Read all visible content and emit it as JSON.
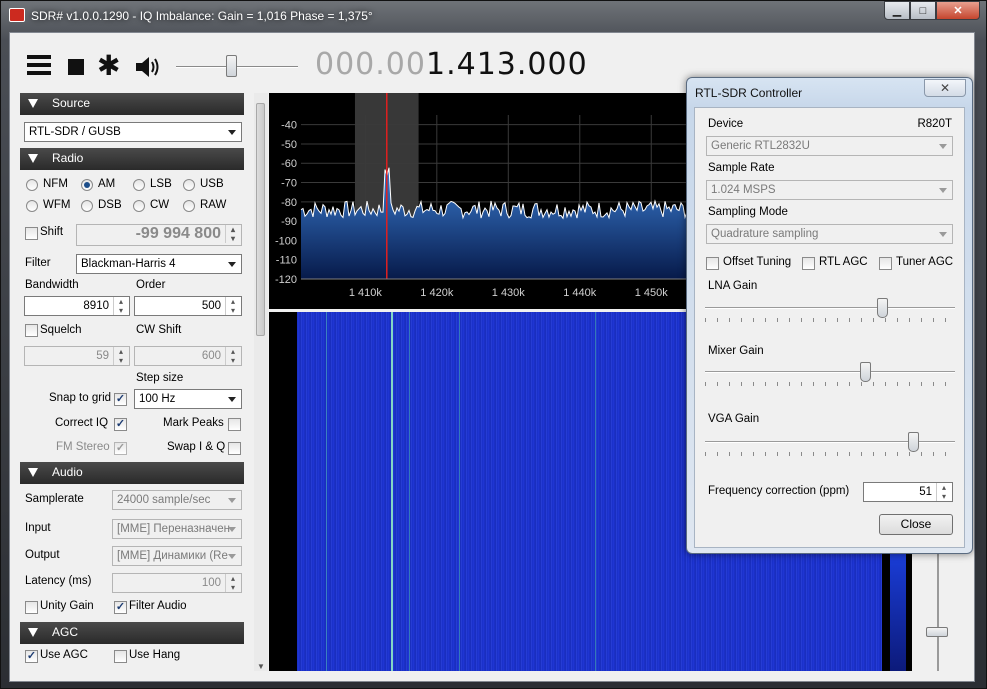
{
  "window": {
    "title": "SDR# v1.0.0.1290 - IQ Imbalance: Gain = 1,016 Phase = 1,375°",
    "minimize_glyph": "▁",
    "maximize_glyph": "□",
    "close_glyph": "✕"
  },
  "toolbar": {
    "frequency_dim": "000.00",
    "frequency_lit": "1.413.000",
    "gear_glyph": "✱"
  },
  "source": {
    "header": "Source",
    "device": "RTL-SDR / GUSB"
  },
  "radio": {
    "header": "Radio",
    "modes": [
      {
        "label": "NFM",
        "selected": false
      },
      {
        "label": "AM",
        "selected": true
      },
      {
        "label": "LSB",
        "selected": false
      },
      {
        "label": "USB",
        "selected": false
      },
      {
        "label": "WFM",
        "selected": false
      },
      {
        "label": "DSB",
        "selected": false
      },
      {
        "label": "CW",
        "selected": false
      },
      {
        "label": "RAW",
        "selected": false
      }
    ],
    "shift_label": "Shift",
    "shift_value": "-99 994 800",
    "filter_label": "Filter",
    "filter_value": "Blackman-Harris 4",
    "bandwidth_label": "Bandwidth",
    "bandwidth_value": "8910",
    "order_label": "Order",
    "order_value": "500",
    "squelch_label": "Squelch",
    "squelch_value": "59",
    "cwshift_label": "CW Shift",
    "cwshift_value": "600",
    "step_size_label": "Step size",
    "step_size_value": "100 Hz",
    "snap_label": "Snap to grid",
    "correct_iq_label": "Correct IQ",
    "mark_peaks_label": "Mark Peaks",
    "fm_stereo_label": "FM Stereo",
    "swap_iq_label": "Swap I & Q",
    "check_glyph": "✓"
  },
  "audio": {
    "header": "Audio",
    "samplerate_label": "Samplerate",
    "samplerate_value": "24000 sample/sec",
    "input_label": "Input",
    "input_value": "[MME] Переназначен",
    "output_label": "Output",
    "output_value": "[MME] Динамики (Re",
    "latency_label": "Latency (ms)",
    "latency_value": "100",
    "unity_gain_label": "Unity Gain",
    "filter_audio_label": "Filter Audio"
  },
  "agc": {
    "header": "AGC",
    "use_agc_label": "Use AGC",
    "use_hang_label": "Use Hang"
  },
  "chart_data": {
    "type": "line",
    "title": "",
    "xlabel": "",
    "ylabel": "",
    "y_ticks": [
      "-40",
      "-50",
      "-60",
      "-70",
      "-80",
      "-90",
      "-100",
      "-110",
      "-120"
    ],
    "x_ticks": [
      "1 410k",
      "1 420k",
      "1 430k",
      "1 440k",
      "1 450k"
    ],
    "x_tick_values": [
      1410000,
      1420000,
      1430000,
      1440000,
      1450000
    ],
    "ylim": [
      -120,
      -35
    ],
    "xlim": [
      1401000,
      1455000
    ],
    "noise_floor_db": -84,
    "peak": {
      "x": 1413000,
      "y": -67
    },
    "passband": [
      1408550,
      1417450
    ],
    "grid": true,
    "colors": {
      "trace": "#ffffff",
      "fill_top": "#3a7cd0",
      "fill_bottom": "#071a4a",
      "grid": "#3a3a3a",
      "tuned": "#e02020"
    }
  },
  "controller": {
    "title": "RTL-SDR Controller",
    "close_glyph": "✕",
    "device_label": "Device",
    "tuner": "R820T",
    "device_value": "Generic RTL2832U",
    "sample_rate_label": "Sample Rate",
    "sample_rate_value": "1.024 MSPS",
    "sampling_mode_label": "Sampling Mode",
    "sampling_mode_value": "Quadrature sampling",
    "offset_tuning_label": "Offset Tuning",
    "rtl_agc_label": "RTL AGC",
    "tuner_agc_label": "Tuner AGC",
    "lna_gain_label": "LNA Gain",
    "lna_gain_level": 0.72,
    "mixer_gain_label": "Mixer Gain",
    "mixer_gain_level": 0.65,
    "vga_gain_label": "VGA Gain",
    "vga_gain_level": 0.85,
    "freq_corr_label": "Frequency correction (ppm)",
    "freq_corr_value": "51",
    "close_button": "Close"
  }
}
